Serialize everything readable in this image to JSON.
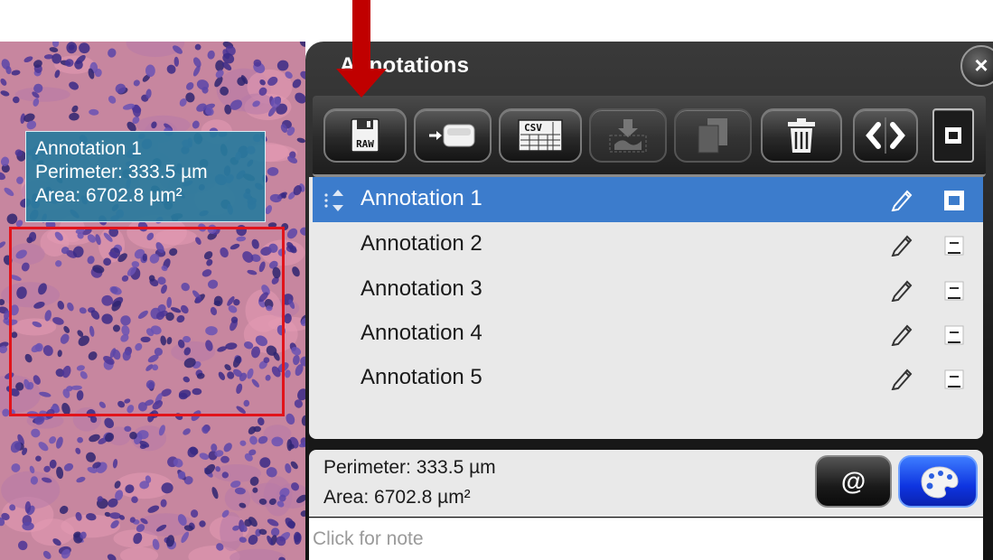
{
  "panel": {
    "title": "Annotations",
    "close_label": "×"
  },
  "tooltip": {
    "name": "Annotation 1",
    "perimeter": "Perimeter: 333.5 µm",
    "area": "Area: 6702.8 µm²"
  },
  "toolbar": {
    "buttons": [
      {
        "name": "export-raw",
        "icon": "save-raw-icon",
        "label": "RAW",
        "enabled": true
      },
      {
        "name": "export-device",
        "icon": "export-to-device-icon",
        "enabled": true
      },
      {
        "name": "export-csv",
        "icon": "csv-table-icon",
        "label": "CSV",
        "enabled": true
      },
      {
        "name": "import",
        "icon": "import-icon",
        "enabled": false
      },
      {
        "name": "copy",
        "icon": "copy-icon",
        "enabled": false
      },
      {
        "name": "delete",
        "icon": "trash-icon",
        "enabled": true
      },
      {
        "name": "prev-next",
        "icon": "chevron-left-right-icon",
        "enabled": true
      },
      {
        "name": "toggle-all",
        "icon": "square-icon",
        "enabled": true
      }
    ]
  },
  "annotations": [
    {
      "label": "Annotation 1",
      "selected": true
    },
    {
      "label": "Annotation 2",
      "selected": false
    },
    {
      "label": "Annotation 3",
      "selected": false
    },
    {
      "label": "Annotation 4",
      "selected": false
    },
    {
      "label": "Annotation 5",
      "selected": false
    }
  ],
  "details": {
    "perimeter": "Perimeter: 333.5 µm",
    "area": "Area: 6702.8 µm²",
    "at_label": "@"
  },
  "note": {
    "placeholder": "Click for note"
  },
  "colors": {
    "selection_rect": "#e1141b",
    "tooltip_bg": "#287b9c",
    "row_selected": "#3c7ccc",
    "arrow": "#c00000",
    "palette_button": "#0e34e0"
  }
}
